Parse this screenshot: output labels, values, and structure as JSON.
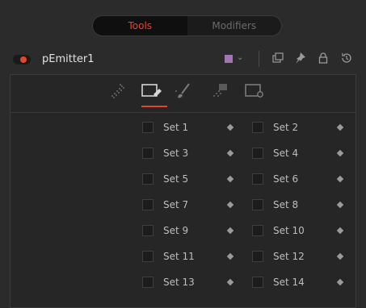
{
  "top_tabs": [
    "Tools",
    "Modifiers"
  ],
  "node": {
    "name": "pEmitter1",
    "color": "#a276b3",
    "accent": "#e8432b"
  },
  "header_icons": [
    "color-swatch",
    "chevron-down-icon",
    "versions-icon",
    "pin-icon",
    "lock-icon",
    "reset-icon"
  ],
  "panel_tabs": [
    "controls-tab",
    "sets-tab",
    "style-tab",
    "region-tab",
    "settings-tab"
  ],
  "active_panel_tab": "sets-tab",
  "sets": [
    [
      "Set 1",
      "Set 2"
    ],
    [
      "Set 3",
      "Set 4"
    ],
    [
      "Set 5",
      "Set 6"
    ],
    [
      "Set 7",
      "Set 8"
    ],
    [
      "Set 9",
      "Set 10"
    ],
    [
      "Set 11",
      "Set 12"
    ],
    [
      "Set 13",
      "Set 14"
    ]
  ]
}
